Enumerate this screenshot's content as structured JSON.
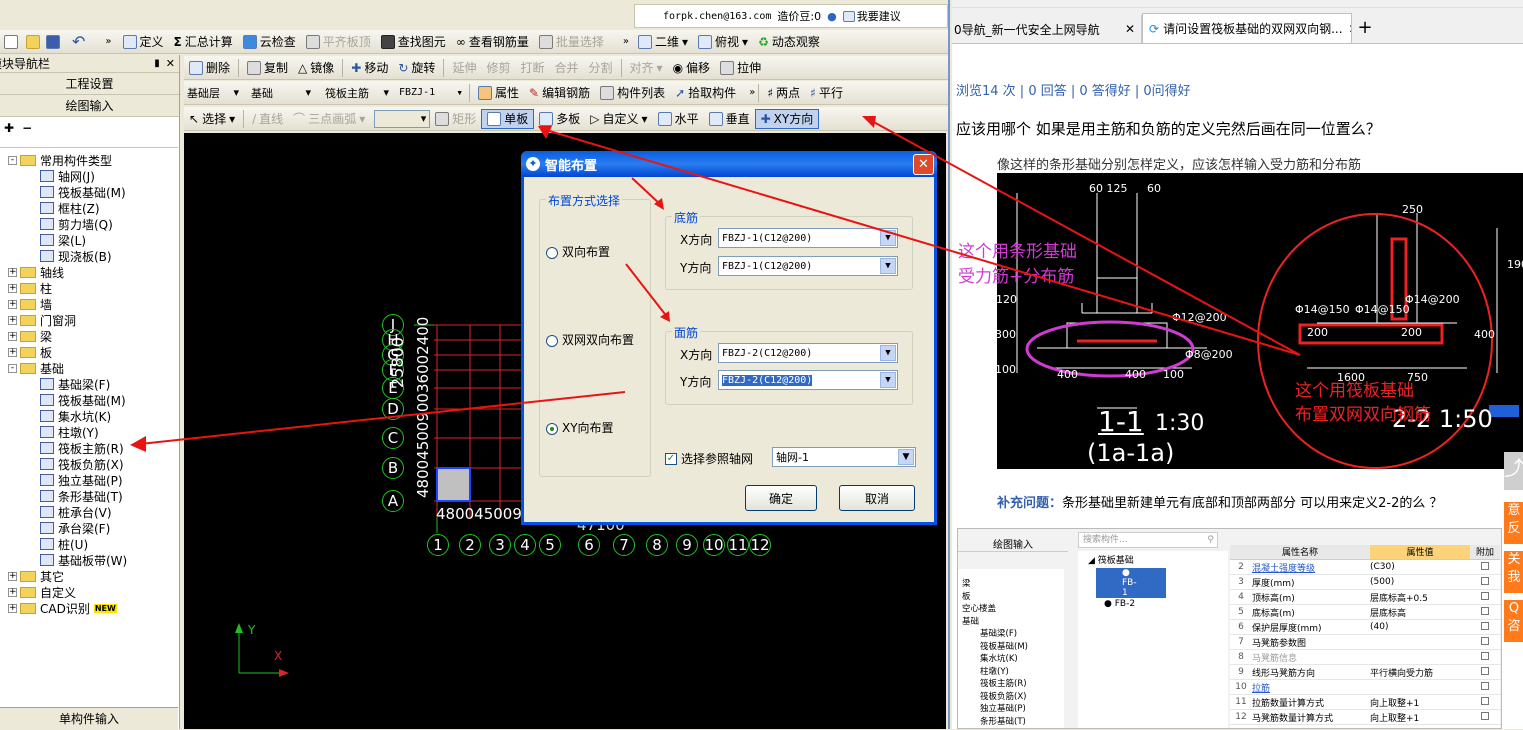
{
  "top_bar": {
    "email": "forpk.chen@163.com",
    "beans": "造价豆:0",
    "suggest": "我要建议"
  },
  "toolbar1": {
    "items": [
      "定义",
      "汇总计算",
      "云检查",
      "平齐板顶",
      "查找图元",
      "查看钢筋量",
      "批量选择",
      "二维",
      "俯视",
      "动态观察"
    ]
  },
  "toolbar2": {
    "items": [
      "删除",
      "复制",
      "镜像",
      "移动",
      "旋转",
      "延伸",
      "修剪",
      "打断",
      "合并",
      "分割",
      "对齐",
      "偏移",
      "拉伸"
    ]
  },
  "toolbar3": {
    "layer": "基础层",
    "category": "基础",
    "type": "筏板主筋",
    "name": "FBZJ-1",
    "items": [
      "属性",
      "编辑钢筋",
      "构件列表",
      "拾取构件",
      "两点",
      "平行"
    ]
  },
  "toolbar4": {
    "items": [
      "选择",
      "直线",
      "三点画弧",
      "矩形",
      "单板",
      "多板",
      "自定义",
      "水平",
      "垂直",
      "XY方向"
    ]
  },
  "nav": {
    "title": "模块导航栏",
    "tab1": "工程设置",
    "tab2": "绘图输入",
    "bottom": "单构件输入",
    "tree": [
      {
        "label": "常用构件类型",
        "level": 0,
        "kind": "folder",
        "exp": "-"
      },
      {
        "label": "轴网(J)",
        "level": 1,
        "kind": "leaf"
      },
      {
        "label": "筏板基础(M)",
        "level": 1,
        "kind": "leaf"
      },
      {
        "label": "框柱(Z)",
        "level": 1,
        "kind": "leaf"
      },
      {
        "label": "剪力墙(Q)",
        "level": 1,
        "kind": "leaf"
      },
      {
        "label": "梁(L)",
        "level": 1,
        "kind": "leaf"
      },
      {
        "label": "现浇板(B)",
        "level": 1,
        "kind": "leaf"
      },
      {
        "label": "轴线",
        "level": 0,
        "kind": "folder",
        "exp": "+"
      },
      {
        "label": "柱",
        "level": 0,
        "kind": "folder",
        "exp": "+"
      },
      {
        "label": "墙",
        "level": 0,
        "kind": "folder",
        "exp": "+"
      },
      {
        "label": "门窗洞",
        "level": 0,
        "kind": "folder",
        "exp": "+"
      },
      {
        "label": "梁",
        "level": 0,
        "kind": "folder",
        "exp": "+"
      },
      {
        "label": "板",
        "level": 0,
        "kind": "folder",
        "exp": "+"
      },
      {
        "label": "基础",
        "level": 0,
        "kind": "folder",
        "exp": "-"
      },
      {
        "label": "基础梁(F)",
        "level": 1,
        "kind": "leaf"
      },
      {
        "label": "筏板基础(M)",
        "level": 1,
        "kind": "leaf"
      },
      {
        "label": "集水坑(K)",
        "level": 1,
        "kind": "leaf"
      },
      {
        "label": "柱墩(Y)",
        "level": 1,
        "kind": "leaf"
      },
      {
        "label": "筏板主筋(R)",
        "level": 1,
        "kind": "leaf"
      },
      {
        "label": "筏板负筋(X)",
        "level": 1,
        "kind": "leaf"
      },
      {
        "label": "独立基础(P)",
        "level": 1,
        "kind": "leaf"
      },
      {
        "label": "条形基础(T)",
        "level": 1,
        "kind": "leaf"
      },
      {
        "label": "桩承台(V)",
        "level": 1,
        "kind": "leaf"
      },
      {
        "label": "承台梁(F)",
        "level": 1,
        "kind": "leaf"
      },
      {
        "label": "桩(U)",
        "level": 1,
        "kind": "leaf"
      },
      {
        "label": "基础板带(W)",
        "level": 1,
        "kind": "leaf"
      },
      {
        "label": "其它",
        "level": 0,
        "kind": "folder",
        "exp": "+"
      },
      {
        "label": "自定义",
        "level": 0,
        "kind": "folder",
        "exp": "+"
      },
      {
        "label": "CAD识别",
        "level": 0,
        "kind": "folder",
        "exp": "+",
        "badge": "NEW"
      }
    ]
  },
  "canvas": {
    "row_labels": [
      "J",
      "H",
      "G",
      "F",
      "E",
      "D",
      "C",
      "B",
      "A"
    ],
    "col_labels": [
      "1",
      "2",
      "3",
      "4",
      "5",
      "6",
      "7",
      "8",
      "9",
      "10",
      "11",
      "12"
    ],
    "vertical_dims": "25800",
    "vertical_dims2": "4800450090036002400",
    "bottom_dim": "47100",
    "bottom_dims2": "4800450090",
    "y_axis": "Y",
    "x_axis": "X"
  },
  "dialog": {
    "title": "智能布置",
    "group_main": "布置方式选择",
    "options": [
      "双向布置",
      "双网双向布置",
      "XY向布置"
    ],
    "selected": "XY向布置",
    "bottom_group": "底筋",
    "top_group": "面筋",
    "x_label": "X方向",
    "y_label": "Y方向",
    "bottom_x": "FBZJ-1(C12@200)",
    "bottom_y": "FBZJ-1(C12@200)",
    "top_x": "FBZJ-2(C12@200)",
    "top_y": "FBZJ-2(C12@200)",
    "ref_axis_label": "选择参照轴网",
    "ref_axis_value": "轴网-1",
    "ok": "确定",
    "cancel": "取消"
  },
  "browser": {
    "tabs": [
      "0导航_新一代安全上网导航",
      "请问设置筏板基础的双网双向钢..."
    ],
    "stats": "浏览14 次 | 0 回答 | 0 答得好 | 0问得好",
    "question": "应该用哪个 如果是用主筋和负筋的定义完然后画在同一位置么？",
    "caption": "像这样的条形基础分别怎样定义，应该怎样输入受力筋和分布筋",
    "note_left_1": "这个用条形基础",
    "note_left_2": "受力筋+分布筋",
    "note_right_1": "这个用筏板基础",
    "note_right_2": "布置双网双向钢筋",
    "section_label": "1-1",
    "section_scale": "1:30",
    "section_sub": "(1a-1a)",
    "section2_label": "2-2",
    "section2_scale": "1:50",
    "supplement_label": "补充问题：",
    "supplement": "条形基础里新建单元有底部和顶部两部分 可以用来定义2-2的么 ？",
    "side_btns": [
      "意反",
      "关我",
      "Q咨"
    ]
  },
  "sub_screenshot": {
    "left_tab": "绘图输入",
    "search_placeholder": "搜索构件...",
    "left_tree": [
      "梁",
      "板",
      "空心楼盖",
      "基础",
      "基础梁(F)",
      "筏板基础(M)",
      "集水坑(K)",
      "柱墩(Y)",
      "筏板主筋(R)",
      "筏板负筋(X)",
      "独立基础(P)",
      "条形基础(T)"
    ],
    "mid_tree_root": "筏板基础",
    "mid_tree_items": [
      "FB-1",
      "FB-2"
    ],
    "prop_header": [
      "属性名称",
      "属性值",
      "附加"
    ],
    "props": [
      {
        "n": "2",
        "name": "混凝土强度等级",
        "val": "(C30)"
      },
      {
        "n": "3",
        "name": "厚度(mm)",
        "val": "(500)"
      },
      {
        "n": "4",
        "name": "顶标高(m)",
        "val": "层底标高+0.5"
      },
      {
        "n": "5",
        "name": "底标高(m)",
        "val": "层底标高"
      },
      {
        "n": "6",
        "name": "保护层厚度(mm)",
        "val": "(40)"
      },
      {
        "n": "7",
        "name": "马凳筋参数图",
        "val": ""
      },
      {
        "n": "8",
        "name": "马凳筋信息",
        "val": ""
      },
      {
        "n": "9",
        "name": "线形马凳筋方向",
        "val": "平行横向受力筋"
      },
      {
        "n": "10",
        "name": "拉筋",
        "val": ""
      },
      {
        "n": "11",
        "name": "拉筋数量计算方式",
        "val": "向上取整+1"
      },
      {
        "n": "12",
        "name": "马凳筋数量计算方式",
        "val": "向上取整+1"
      }
    ]
  }
}
